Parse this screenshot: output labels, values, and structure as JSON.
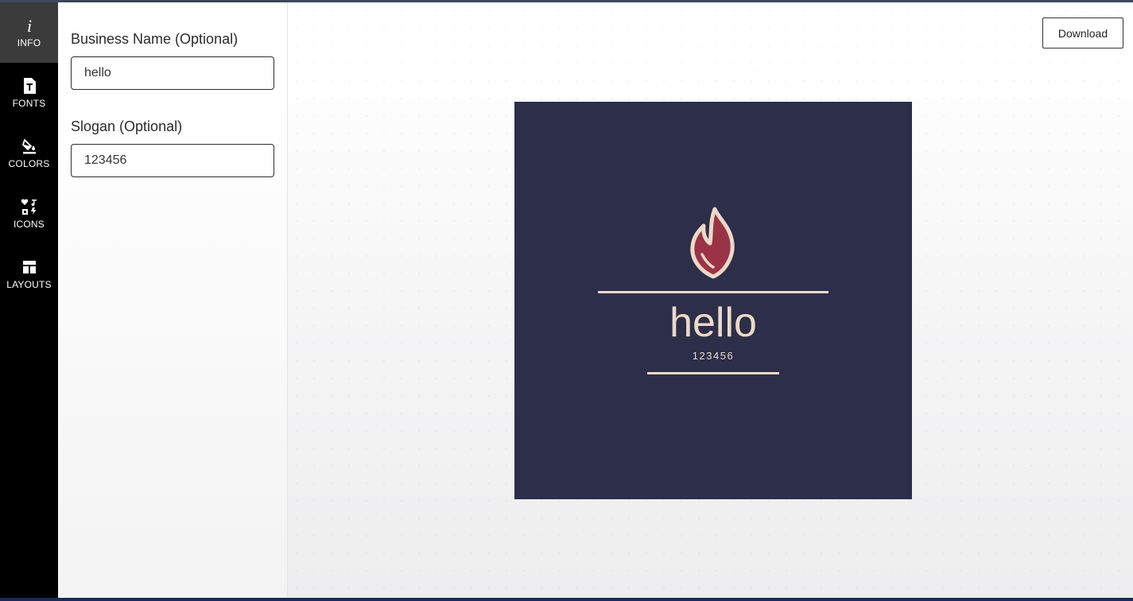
{
  "rail": {
    "items": [
      {
        "label": "INFO",
        "icon": "info-icon"
      },
      {
        "label": "FONTS",
        "icon": "font-file-icon"
      },
      {
        "label": "COLORS",
        "icon": "paint-bucket-icon"
      },
      {
        "label": "ICONS",
        "icon": "icon-shapes-icon"
      },
      {
        "label": "LAYOUTS",
        "icon": "layout-icon"
      }
    ],
    "active": "INFO"
  },
  "form": {
    "business_name": {
      "label": "Business Name (Optional)",
      "value": "hello"
    },
    "slogan": {
      "label": "Slogan (Optional)",
      "value": "123456"
    }
  },
  "toolbar": {
    "download_label": "Download"
  },
  "logo": {
    "name": "hello",
    "slogan": "123456",
    "icon": "flame-icon",
    "background_color": "#2c2e4a",
    "text_color": "#ecd9c6",
    "icon_color": "#9b3346"
  }
}
